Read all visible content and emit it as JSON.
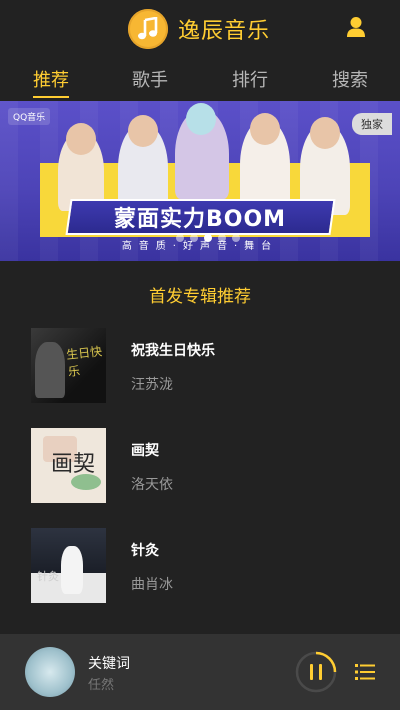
{
  "app": {
    "title": "逸辰音乐",
    "logo_icon": "music-note-icon",
    "accent": "#ffcd32"
  },
  "tabs": [
    {
      "label": "推荐",
      "active": true
    },
    {
      "label": "歌手",
      "active": false
    },
    {
      "label": "排行",
      "active": false
    },
    {
      "label": "搜索",
      "active": false
    }
  ],
  "banner": {
    "source_label": "QQ音乐",
    "badge": "独家",
    "title": "蒙面实力BOOM",
    "subtitle": "高音质·好声音·舞台",
    "slide_count": 5,
    "active_slide": 2
  },
  "section": {
    "title": "首发专辑推荐"
  },
  "albums": [
    {
      "name": "祝我生日快乐",
      "artist": "汪苏泷",
      "cover_text": "生日快乐"
    },
    {
      "name": "画契",
      "artist": "洛天依",
      "cover_text": "画契"
    },
    {
      "name": "针灸",
      "artist": "曲肖冰",
      "cover_text": "针灸"
    }
  ],
  "player": {
    "song": "关键词",
    "singer": "任然",
    "state": "playing",
    "progress": 0.25,
    "controls": [
      "pause-icon",
      "playlist-icon"
    ]
  }
}
